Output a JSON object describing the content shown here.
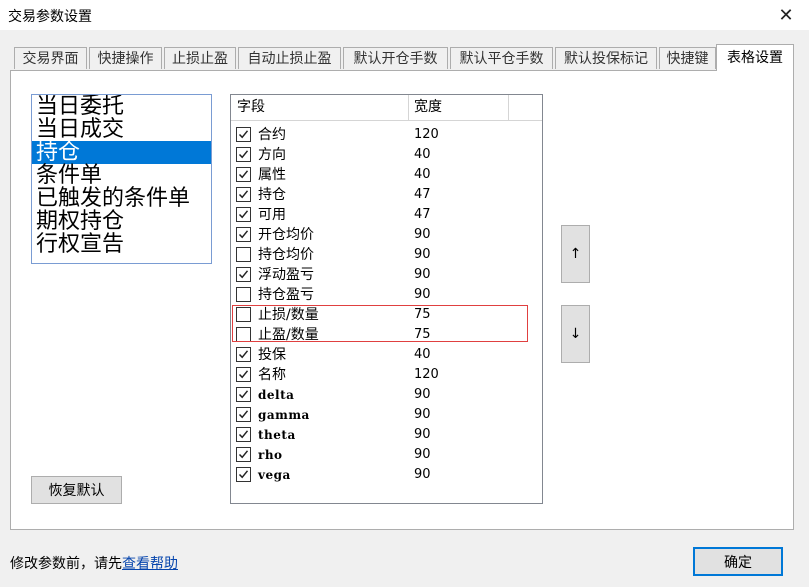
{
  "window": {
    "title": "交易参数设置"
  },
  "tabs": [
    {
      "label": "交易界面"
    },
    {
      "label": "快捷操作"
    },
    {
      "label": "止损止盈"
    },
    {
      "label": "自动止损止盈"
    },
    {
      "label": "默认开仓手数"
    },
    {
      "label": "默认平仓手数"
    },
    {
      "label": "默认投保标记"
    },
    {
      "label": "快捷键"
    },
    {
      "label": "表格设置",
      "active": true
    }
  ],
  "table_list": {
    "items": [
      {
        "label": "当日委托"
      },
      {
        "label": "当日成交"
      },
      {
        "label": "持仓",
        "selected": true
      },
      {
        "label": "条件单"
      },
      {
        "label": "已触发的条件单"
      },
      {
        "label": "期权持仓"
      },
      {
        "label": "行权宣告"
      }
    ]
  },
  "grid": {
    "col_field": "字段",
    "col_width": "宽度",
    "rows": [
      {
        "field": "合约",
        "width": "120",
        "checked": true
      },
      {
        "field": "方向",
        "width": "40",
        "checked": true
      },
      {
        "field": "属性",
        "width": "40",
        "checked": true
      },
      {
        "field": "持仓",
        "width": "47",
        "checked": true
      },
      {
        "field": "可用",
        "width": "47",
        "checked": true
      },
      {
        "field": "开仓均价",
        "width": "90",
        "checked": true
      },
      {
        "field": "持仓均价",
        "width": "90",
        "checked": false
      },
      {
        "field": "浮动盈亏",
        "width": "90",
        "checked": true
      },
      {
        "field": "持仓盈亏",
        "width": "90",
        "checked": false
      },
      {
        "field": "止损/数量",
        "width": "75",
        "checked": false
      },
      {
        "field": "止盈/数量",
        "width": "75",
        "checked": false
      },
      {
        "field": "投保",
        "width": "40",
        "checked": true
      },
      {
        "field": "名称",
        "width": "120",
        "checked": true
      },
      {
        "field": "delta",
        "width": "90",
        "checked": true
      },
      {
        "field": "gamma",
        "width": "90",
        "checked": true
      },
      {
        "field": "theta",
        "width": "90",
        "checked": true
      },
      {
        "field": "rho",
        "width": "90",
        "checked": true
      },
      {
        "field": "vega",
        "width": "90",
        "checked": true
      }
    ]
  },
  "buttons": {
    "move_up": "↑",
    "move_down": "↓",
    "restore_default": "恢复默认",
    "ok": "确定"
  },
  "footer": {
    "hint": "修改参数前，请先",
    "help_link": "查看帮助"
  },
  "icons": {
    "close": "close-icon",
    "check": "check-icon"
  },
  "colors": {
    "selection": "#0078d7",
    "highlight_border": "#e04040",
    "link": "#0645ad"
  }
}
